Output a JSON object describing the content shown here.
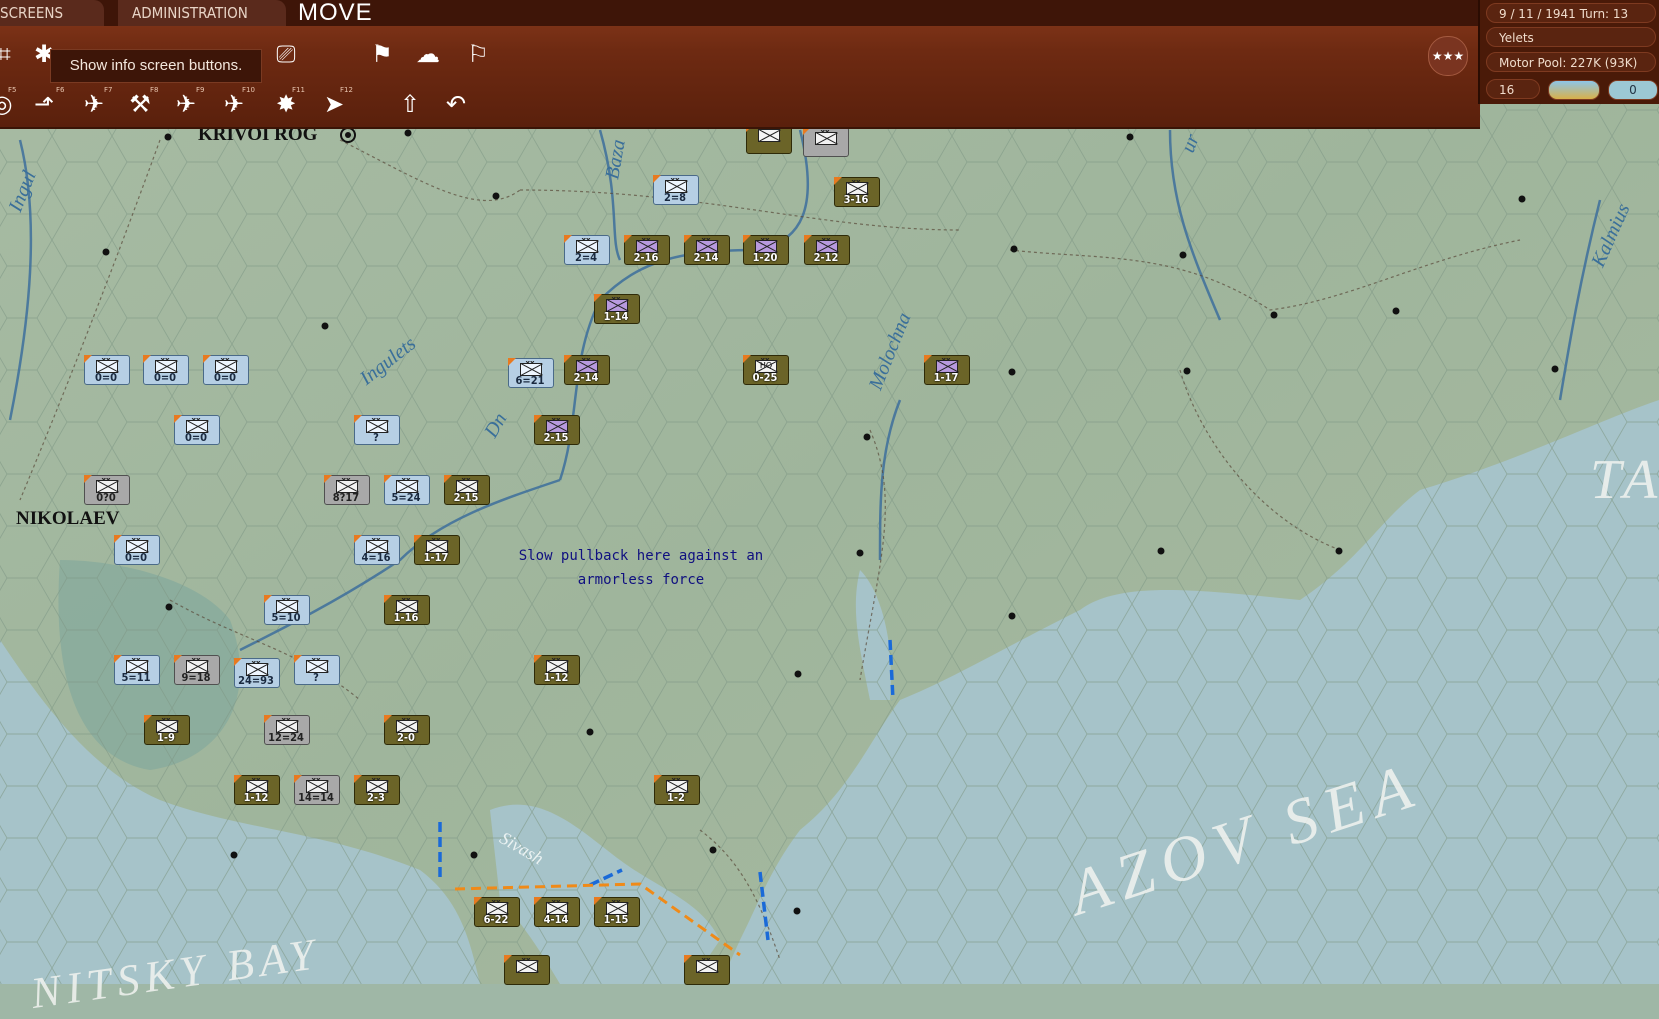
{
  "top_tabs": {
    "screens": "SCREENS",
    "administration": "ADMINISTRATION"
  },
  "phase": "MOVE",
  "tooltip": "Show info screen buttons.",
  "function_keys": [
    "F5",
    "F6",
    "F7",
    "F8",
    "F9",
    "F10",
    "F11",
    "F12"
  ],
  "status": {
    "date_turn": "9 / 11 / 1941  Turn: 13",
    "location": "Yelets",
    "motor_pool": "Motor Pool:  227K (93K)",
    "count": "16",
    "small_box": "0"
  },
  "map_labels": {
    "krivoi_rog": "KRIVOI ROG",
    "nikolaev": "NIKOLAEV",
    "ingul": "Ingul",
    "ingulets": "Ingulets",
    "dnepr": "Dn",
    "bazavluk": "Baza",
    "molochna": "Molochna",
    "kalmius": "Kalmius",
    "sivash": "Sivash",
    "azov_sea": "AZOV SEA",
    "bay": "NITSKY BAY",
    "ta": "TA",
    "ur": "ur"
  },
  "note": "Slow pullback here against an armorless force",
  "units": [
    {
      "side": "ger",
      "label": ""
    },
    {
      "side": "gry",
      "label": ""
    },
    {
      "side": "ger",
      "label": "3-16"
    },
    {
      "side": "sov",
      "label": "2=8"
    },
    {
      "side": "sov",
      "label": "2=4"
    },
    {
      "side": "ger",
      "label": "2-16",
      "pz": true
    },
    {
      "side": "ger",
      "label": "2-14",
      "pz": true
    },
    {
      "side": "ger",
      "label": "1-20",
      "pz": true
    },
    {
      "side": "ger",
      "label": "2-12",
      "pz": true
    },
    {
      "side": "ger",
      "label": "1-14",
      "pz": true
    },
    {
      "side": "sov",
      "label": "0=0"
    },
    {
      "side": "sov",
      "label": "0=0"
    },
    {
      "side": "sov",
      "label": "0=0"
    },
    {
      "side": "sov",
      "label": "6=21"
    },
    {
      "side": "ger",
      "label": "2-14",
      "pz": true
    },
    {
      "side": "ger",
      "label": "0-25",
      "hq": "HQ"
    },
    {
      "side": "ger",
      "label": "1-17",
      "pz": true
    },
    {
      "side": "sov",
      "label": "0=0"
    },
    {
      "side": "sov",
      "label": "?"
    },
    {
      "side": "ger",
      "label": "2-15",
      "pz": true
    },
    {
      "side": "gry",
      "label": "0?0"
    },
    {
      "side": "gry",
      "label": "8?17"
    },
    {
      "side": "sov",
      "label": "5=24"
    },
    {
      "side": "ger",
      "label": "2-15"
    },
    {
      "side": "sov",
      "label": "0=0"
    },
    {
      "side": "sov",
      "label": "4=16"
    },
    {
      "side": "ger",
      "label": "1-17"
    },
    {
      "side": "sov",
      "label": "5=10"
    },
    {
      "side": "ger",
      "label": "1-16"
    },
    {
      "side": "ger",
      "label": "1-12"
    },
    {
      "side": "sov",
      "label": "5=11"
    },
    {
      "side": "gry",
      "label": "9=18"
    },
    {
      "side": "sov",
      "label": "24=93"
    },
    {
      "side": "sov",
      "label": "?"
    },
    {
      "side": "ger",
      "label": "1-9"
    },
    {
      "side": "gry",
      "label": "12=24"
    },
    {
      "side": "ger",
      "label": "2-0"
    },
    {
      "side": "ger",
      "label": "1-12"
    },
    {
      "side": "gry",
      "label": "14=14"
    },
    {
      "side": "ger",
      "label": "2-3"
    },
    {
      "side": "ger",
      "label": "1-2"
    },
    {
      "side": "ger",
      "label": "6-22"
    },
    {
      "side": "ger",
      "label": "4-14"
    },
    {
      "side": "ger",
      "label": "1-15"
    },
    {
      "side": "ger",
      "label": ""
    },
    {
      "side": "ger",
      "label": ""
    }
  ],
  "colors": {
    "bar": "#6e2a12",
    "land": "#a8bca6",
    "sea": "#a9c9d2",
    "river": "#3d6f9c"
  }
}
